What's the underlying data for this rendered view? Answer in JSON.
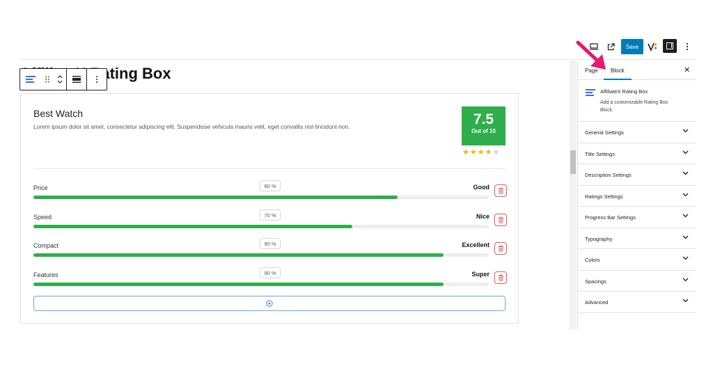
{
  "toolbar": {
    "save_label": "Save",
    "icons": [
      "desktop-preview-icon",
      "external-link-icon",
      "yoast-seo-icon",
      "sidebar-toggle-icon",
      "more-options-icon"
    ]
  },
  "editor": {
    "page_title": "AffiliateX Rating Box"
  },
  "rating_box": {
    "title": "Best Watch",
    "description": "Lorem ipsum dolor sit amet, consectetur adipiscing elit. Suspendisse vehicula mauris velit, eget convallis nisl tincidunt non.",
    "score": "7.5",
    "score_label": "Out of 10",
    "stars": {
      "filled": 4,
      "total": 5
    },
    "bars": [
      {
        "label": "Price",
        "percent_label": "80 %",
        "value": 0.8,
        "status": "Good"
      },
      {
        "label": "Speed",
        "percent_label": "70 %",
        "value": 0.7,
        "status": "Nice"
      },
      {
        "label": "Compact",
        "percent_label": "90 %",
        "value": 0.9,
        "status": "Excellent"
      },
      {
        "label": "Features",
        "percent_label": "90 %",
        "value": 0.9,
        "status": "Super"
      }
    ]
  },
  "sidebar": {
    "tabs": [
      "Page",
      "Block"
    ],
    "active_tab": "Block",
    "block_card": {
      "title": "AffiliateX Rating Box",
      "description": "Add a customizable Rating Box Block."
    },
    "panels": [
      "General Settings",
      "Title Settings",
      "Description Settings",
      "Ratings Settings",
      "Progress Bar Settings",
      "Typography",
      "Colors",
      "Spacings",
      "Advanced"
    ]
  },
  "colors": {
    "accent": "#007cba",
    "score_bg": "#2fae4b",
    "bar_fill": "#2fae4b",
    "star": "#f5b301",
    "delete": "#e05b5b",
    "annotation_arrow": "#e8186d"
  }
}
